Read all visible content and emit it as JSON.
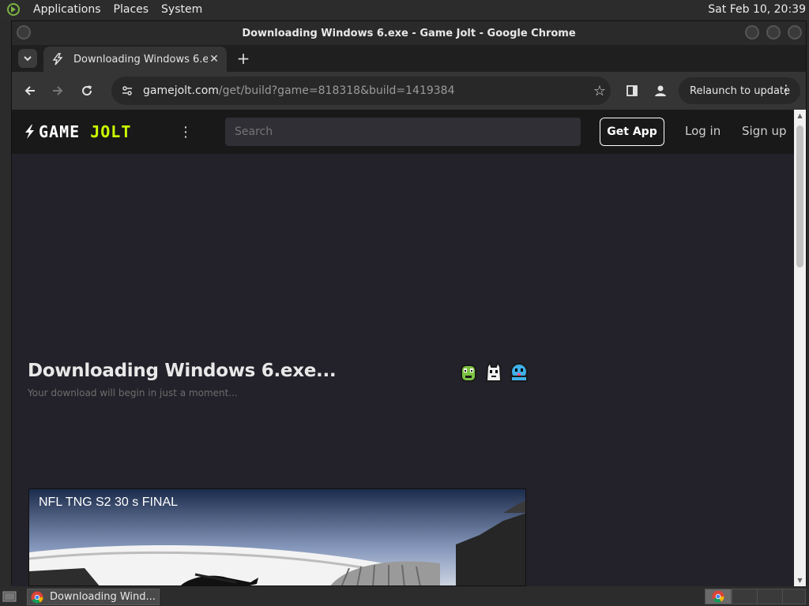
{
  "top_panel": {
    "menus": [
      "Applications",
      "Places",
      "System"
    ],
    "clock": "Sat Feb 10, 20:39"
  },
  "window": {
    "title": "Downloading Windows 6.exe - Game Jolt - Google Chrome"
  },
  "tabs": [
    {
      "label": "Downloading Windows 6.exe",
      "favicon": "game-jolt-bolt-icon"
    }
  ],
  "toolbar": {
    "url_host": "gamejolt.com",
    "url_path": "/get/build?game=818318&build=1419384",
    "relaunch_label": "Relaunch to update"
  },
  "gamejolt": {
    "logo_word_1": "GAME",
    "logo_word_2": "JOLT",
    "search_placeholder": "Search",
    "get_app_label": "Get App",
    "login_label": "Log in",
    "signup_label": "Sign up",
    "accent": "#ccff00"
  },
  "download": {
    "title": "Downloading Windows 6.exe...",
    "subtitle": "Your download will begin in just a moment..."
  },
  "video": {
    "title": "NFL TNG S2 30 s FINAL"
  },
  "taskbar": {
    "task_label": "Downloading Wind..."
  }
}
